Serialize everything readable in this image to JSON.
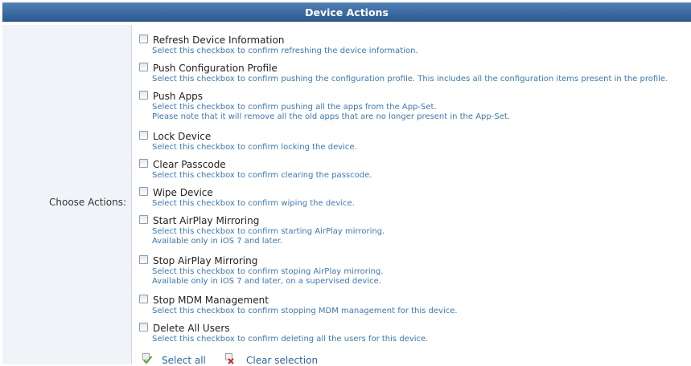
{
  "panel": {
    "title": "Device Actions"
  },
  "form": {
    "label": "Choose Actions:"
  },
  "actions": [
    {
      "title": "Refresh Device Information",
      "desc1": "Select this checkbox to confirm refreshing the device information."
    },
    {
      "title": "Push Configuration Profile",
      "desc1": "Select this checkbox to confirm pushing the configuration profile. This includes all the configuration items present in the profile."
    },
    {
      "title": "Push Apps",
      "desc1": "Select this checkbox to confirm pushing all the apps from the App-Set.",
      "desc2": "Please note that it will remove all the old apps that are no longer present in the App-Set."
    },
    {
      "title": "Lock Device",
      "desc1": "Select this checkbox to confirm locking the device."
    },
    {
      "title": "Clear Passcode",
      "desc1": "Select this checkbox to confirm clearing the passcode."
    },
    {
      "title": "Wipe Device",
      "desc1": "Select this checkbox to confirm wiping the device."
    },
    {
      "title": "Start AirPlay Mirroring",
      "desc1": "Select this checkbox to confirm starting AirPlay mirroring.",
      "desc2": "Available only in iOS 7 and later."
    },
    {
      "title": "Stop AirPlay Mirroring",
      "desc1": "Select this checkbox to confirm stoping AirPlay mirroring.",
      "desc2": "Available only in iOS 7 and later, on a supervised device."
    },
    {
      "title": "Stop MDM Management",
      "desc1": "Select this checkbox to confirm stopping MDM management for this device."
    },
    {
      "title": "Delete All Users",
      "desc1": "Select this checkbox to confirm deleting all the users for this device."
    }
  ],
  "footer": {
    "select_all": "Select all",
    "clear_selection": "Clear selection",
    "select_icon": "checkbox-checkmark-icon",
    "clear_icon": "checkbox-x-icon",
    "check_color": "#5aa02c",
    "x_color": "#c62828"
  },
  "colors": {
    "header_bg": "#3b6aa0",
    "description": "#3a78b6",
    "link": "#2a66a6",
    "label_bg": "#f0f4f8"
  }
}
